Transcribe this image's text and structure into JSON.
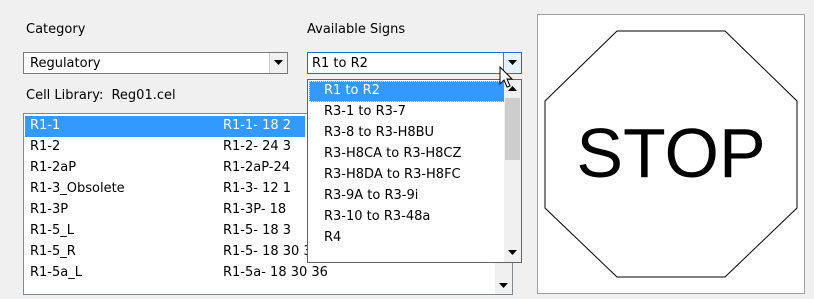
{
  "category": {
    "label": "Category",
    "value": "Regulatory"
  },
  "available_signs": {
    "label": "Available Signs",
    "value": "R1 to R2",
    "options": [
      "R1 to R2",
      "R3-1 to R3-7",
      "R3-8 to R3-H8BU",
      "R3-H8CA to R3-H8CZ",
      "R3-H8DA to R3-H8FC",
      "R3-9A to R3-9i",
      "R3-10 to R3-48a",
      "R4"
    ]
  },
  "cell_library": {
    "label": "Cell Library:",
    "file": "Reg01.cel"
  },
  "cells": [
    {
      "name": "R1-1",
      "desc": "R1-1- 18 2"
    },
    {
      "name": "R1-2",
      "desc": "R1-2- 24 3"
    },
    {
      "name": "R1-2aP",
      "desc": "R1-2aP-24"
    },
    {
      "name": "R1-3_Obsolete",
      "desc": "R1-3- 12 1"
    },
    {
      "name": "R1-3P",
      "desc": "R1-3P- 18"
    },
    {
      "name": "R1-5_L",
      "desc": "R1-5- 18 3"
    },
    {
      "name": "R1-5_R",
      "desc": "R1-5- 18 30 36"
    },
    {
      "name": "R1-5a_L",
      "desc": "R1-5a- 18 30 36"
    }
  ],
  "preview": {
    "sign_text": "STOP"
  },
  "icons": {
    "dropdown_arrow": "chevron-down-icon",
    "scroll_up": "arrow-up-icon",
    "scroll_down": "arrow-down-icon",
    "cursor": "mouse-pointer-icon"
  },
  "colors": {
    "selection": "#3399ff",
    "background": "#f0f0f0"
  }
}
